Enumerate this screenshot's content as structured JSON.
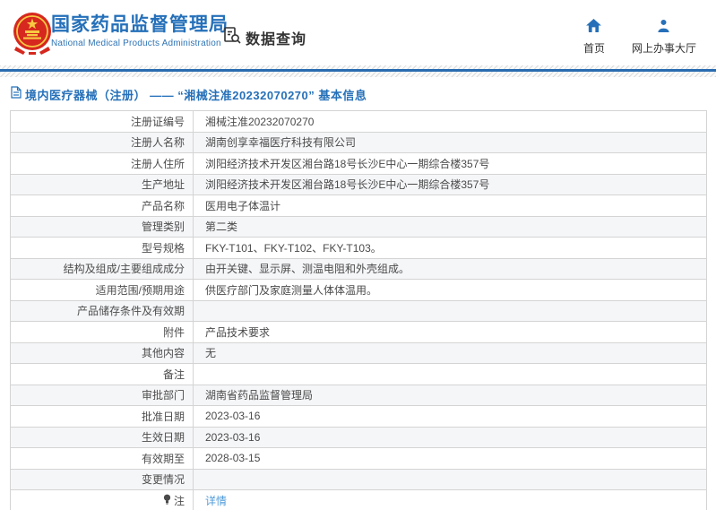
{
  "header": {
    "agency_name_cn": "国家药品监督管理局",
    "agency_name_en": "National Medical Products Administration",
    "section_label": "数据查询",
    "nav": [
      {
        "label": "首页",
        "icon": "home-icon"
      },
      {
        "label": "网上办事大厅",
        "icon": "user-icon"
      }
    ]
  },
  "breadcrumb": {
    "text": "境内医疗器械（注册） —— “湘械注准20232070270” 基本信息"
  },
  "table": {
    "rows": [
      {
        "label": "注册证编号",
        "value": "湘械注准20232070270"
      },
      {
        "label": "注册人名称",
        "value": "湖南创享幸福医疗科技有限公司"
      },
      {
        "label": "注册人住所",
        "value": "浏阳经济技术开发区湘台路18号长沙E中心一期综合楼357号"
      },
      {
        "label": "生产地址",
        "value": "浏阳经济技术开发区湘台路18号长沙E中心一期综合楼357号"
      },
      {
        "label": "产品名称",
        "value": "医用电子体温计"
      },
      {
        "label": "管理类别",
        "value": "第二类"
      },
      {
        "label": "型号规格",
        "value": "FKY-T101、FKY-T102、FKY-T103。"
      },
      {
        "label": "结构及组成/主要组成成分",
        "value": "由开关键、显示屏、测温电阻和外壳组成。"
      },
      {
        "label": "适用范围/预期用途",
        "value": "供医疗部门及家庭测量人体体温用。"
      },
      {
        "label": "产品储存条件及有效期",
        "value": ""
      },
      {
        "label": "附件",
        "value": "产品技术要求"
      },
      {
        "label": "其他内容",
        "value": "无"
      },
      {
        "label": "备注",
        "value": ""
      },
      {
        "label": "审批部门",
        "value": "湖南省药品监督管理局"
      },
      {
        "label": "批准日期",
        "value": "2023-03-16"
      },
      {
        "label": "生效日期",
        "value": "2023-03-16"
      },
      {
        "label": "有效期至",
        "value": "2028-03-15"
      },
      {
        "label": "变更情况",
        "value": ""
      },
      {
        "label": "注",
        "value": "详情",
        "value_is_link": true,
        "label_icon": "bulb-icon"
      }
    ]
  },
  "colors": {
    "brand_blue": "#2570b9",
    "divider_blue": "#2b6cb0",
    "link_blue": "#4f9bd9",
    "emblem_red": "#d6281e",
    "emblem_gold": "#f7c842",
    "row_alt_bg": "#f5f6f8",
    "border_gray": "#d4d4d4"
  }
}
